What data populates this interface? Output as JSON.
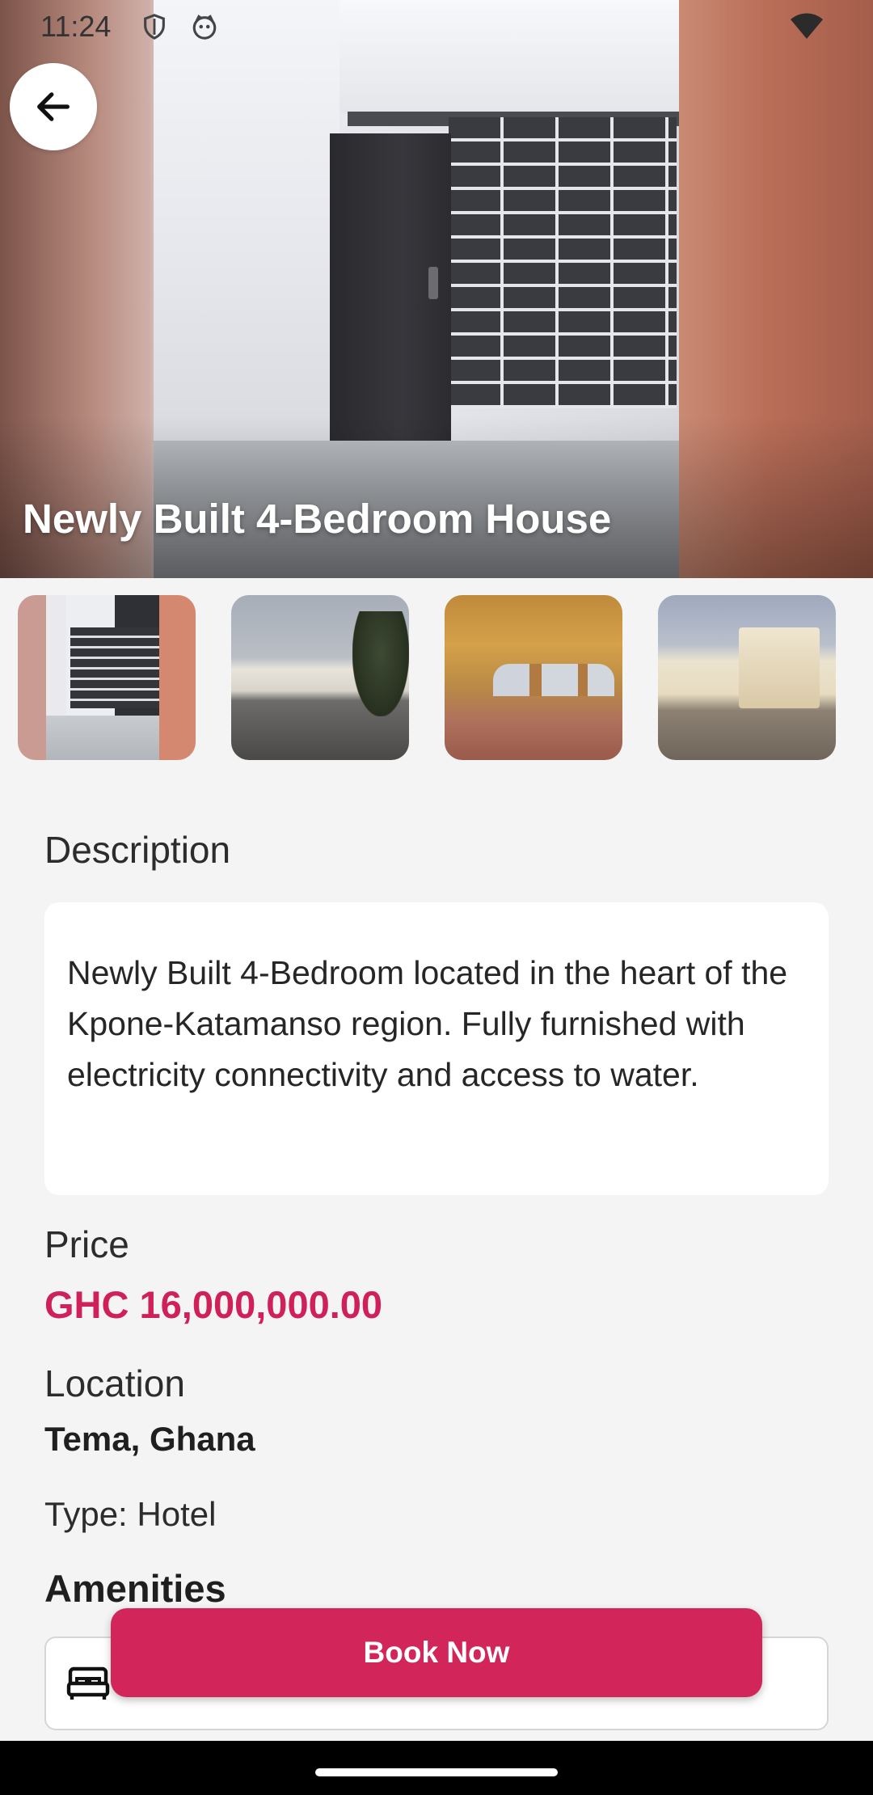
{
  "status_bar": {
    "time": "11:24",
    "icons": [
      "shield-icon",
      "cat-face-icon",
      "wifi-icon"
    ]
  },
  "hero": {
    "title": "Newly Built 4-Bedroom House"
  },
  "thumbnails": [
    {
      "name": "thumbnail-1"
    },
    {
      "name": "thumbnail-2"
    },
    {
      "name": "thumbnail-3"
    },
    {
      "name": "thumbnail-4"
    }
  ],
  "description": {
    "heading": "Description",
    "text": "Newly Built 4-Bedroom located in the heart of the Kpone-Katamanso region. Fully furnished with electricity connectivity and access to water."
  },
  "price": {
    "heading": "Price",
    "value": "GHC 16,000,000.00"
  },
  "location": {
    "heading": "Location",
    "value": "Tema, Ghana"
  },
  "type_line": "Type: Hotel",
  "amenities": {
    "heading": "Amenities",
    "items": [
      {
        "icon": "bed-icon"
      }
    ]
  },
  "book_button": {
    "label": "Book Now"
  },
  "colors": {
    "accent": "#d22559",
    "price": "#d0205a",
    "background": "#f4f4f4"
  }
}
